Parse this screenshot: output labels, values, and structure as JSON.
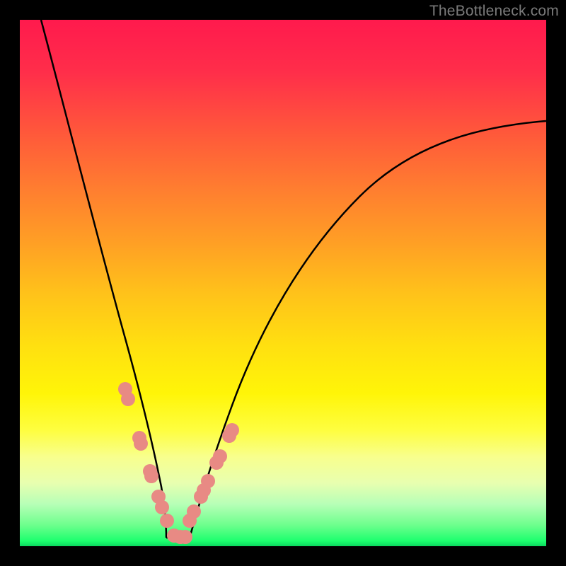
{
  "watermark": "TheBottleneck.com",
  "colors": {
    "background": "#000000",
    "dot": "#e88a84",
    "curve": "#000000"
  },
  "chart_data": {
    "type": "line",
    "title": "",
    "xlabel": "",
    "ylabel": "",
    "xlim": [
      0,
      100
    ],
    "ylim": [
      0,
      100
    ],
    "series": [
      {
        "name": "left-curve",
        "x": [
          4.0,
          6.0,
          8.0,
          10.0,
          12.0,
          14.0,
          16.0,
          18.0,
          20.0,
          21.5,
          23.0,
          24.5,
          25.8,
          27.0,
          27.8
        ],
        "values": [
          100.0,
          89.8,
          80.1,
          70.8,
          61.9,
          53.4,
          45.2,
          37.4,
          30.0,
          24.7,
          19.7,
          14.9,
          11.0,
          7.5,
          5.2
        ]
      },
      {
        "name": "right-curve",
        "x": [
          32.3,
          34.3,
          37.0,
          40.4,
          44.5,
          49.2,
          54.7,
          60.8,
          67.7,
          75.2,
          83.4,
          92.3,
          100.0
        ],
        "values": [
          4.8,
          9.1,
          14.9,
          22.2,
          30.4,
          39.0,
          47.4,
          55.4,
          62.6,
          68.9,
          74.0,
          78.0,
          80.8
        ]
      },
      {
        "name": "flat-bottom",
        "x": [
          27.8,
          32.3
        ],
        "values": [
          1.6,
          1.6
        ]
      }
    ],
    "points": [
      {
        "name": "left-dots",
        "x": [
          20.0,
          20.6,
          22.7,
          23.0,
          24.7,
          25.0,
          26.3,
          27.0,
          27.9,
          29.3,
          30.5,
          31.5
        ],
        "values": [
          29.9,
          28.0,
          20.6,
          19.5,
          14.3,
          13.3,
          9.4,
          7.4,
          4.8,
          2.0,
          1.7,
          1.7
        ]
      },
      {
        "name": "right-dots",
        "x": [
          32.3,
          33.1,
          34.4,
          34.9,
          35.8,
          37.4,
          38.0,
          39.8,
          40.3
        ],
        "values": [
          4.8,
          6.6,
          9.4,
          10.6,
          12.4,
          15.8,
          17.0,
          20.9,
          22.0
        ]
      }
    ],
    "gradient_stops": [
      {
        "pos": 0,
        "color": "#ff1a4d"
      },
      {
        "pos": 50,
        "color": "#ffc21a"
      },
      {
        "pos": 78,
        "color": "#fefe40"
      },
      {
        "pos": 100,
        "color": "#0bd95e"
      }
    ]
  }
}
